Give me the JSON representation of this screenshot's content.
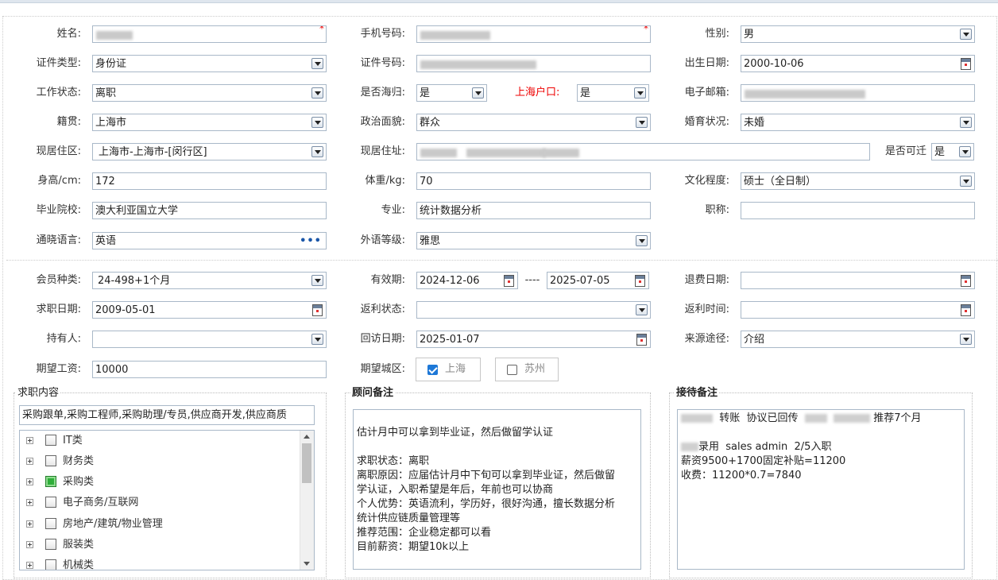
{
  "form": {
    "name_label": "姓名:",
    "phone_label": "手机号码:",
    "gender_label": "性别:",
    "gender_value": "男",
    "idtype_label": "证件类型:",
    "idtype_value": "身份证",
    "idno_label": "证件号码:",
    "birth_label": "出生日期:",
    "birth_value": "2000-10-06",
    "workstatus_label": "工作状态:",
    "workstatus_value": "离职",
    "returnee_label": "是否海归:",
    "returnee_value": "是",
    "hukou_label": "上海户口:",
    "hukou_value": "是",
    "email_label": "电子邮箱:",
    "native_label": "籍贯:",
    "native_value": "上海市",
    "political_label": "政治面貌:",
    "political_value": "群众",
    "marital_label": "婚育状况:",
    "marital_value": "未婚",
    "residence_label": "现居住区:",
    "residence_value": "上海市-上海市-[闵行区]",
    "address_label": "现居住址:",
    "relocate_label": "是否可迁",
    "relocate_value": "是",
    "height_label": "身高/cm:",
    "height_value": "172",
    "weight_label": "体重/kg:",
    "weight_value": "70",
    "education_label": "文化程度:",
    "education_value": "硕士（全日制）",
    "school_label": "毕业院校:",
    "school_value": "澳大利亚国立大学",
    "major_label": "专业:",
    "major_value": "统计数据分析",
    "title_label": "职称:",
    "title_value": "",
    "language_label": "通晓语言:",
    "language_value": "英语",
    "language_more": "•••",
    "level_label": "外语等级:",
    "level_value": "雅思",
    "membership_label": "会员种类:",
    "membership_value": "24-498+1个月",
    "valid_label": "有效期:",
    "valid_from": "2024-12-06",
    "valid_sep": "----",
    "valid_to": "2025-07-05",
    "refund_label": "退费日期:",
    "refund_value": "",
    "jobdate_label": "求职日期:",
    "jobdate_value": "2009-05-01",
    "rebate_status_label": "返利状态:",
    "rebate_status_value": "",
    "rebate_time_label": "返利时间:",
    "rebate_time_value": "",
    "holder_label": "持有人:",
    "holder_value": "",
    "revisit_label": "回访日期:",
    "revisit_value": "2025-01-07",
    "source_label": "来源途径:",
    "source_value": "介绍",
    "salary_label": "期望工资:",
    "salary_value": "10000",
    "city_label": "期望城区:",
    "city_options": [
      {
        "label": "上海",
        "checked": true
      },
      {
        "label": "苏州",
        "checked": false
      }
    ],
    "required_mark": "*"
  },
  "job_panel": {
    "title": "求职内容",
    "summary": "采购跟单,采购工程师,采购助理/专员,供应商开发,供应商质",
    "tree": [
      {
        "label": "IT类",
        "checked": false
      },
      {
        "label": "财务类",
        "checked": false
      },
      {
        "label": "采购类",
        "checked": true
      },
      {
        "label": "电子商务/互联网",
        "checked": false
      },
      {
        "label": "房地产/建筑/物业管理",
        "checked": false
      },
      {
        "label": "服装类",
        "checked": false
      },
      {
        "label": "机械类",
        "checked": false
      }
    ]
  },
  "advisor_panel": {
    "title": "顾问备注",
    "lines": [
      "",
      "估计月中可以拿到毕业证，然后做留学认证",
      "",
      "求职状态：离职",
      "离职原因：应届估计月中下旬可以拿到毕业证，然后做留",
      "学认证，入职希望是年后，年前也可以协商",
      "个人优势：英语流利，学历好，很好沟通，擅长数据分析",
      "统计供应链质量管理等",
      "推荐范围：企业稳定都可以看",
      "目前薪资：期望10k以上"
    ]
  },
  "reception_panel": {
    "title": "接待备注",
    "line1_a": "转账  协议已回传",
    "line1_b": "推荐7个月",
    "line3_a": "录用  sales admin  2/5入职",
    "line4": "薪资9500+1700固定补贴=11200",
    "line5": "收费：11200*0.7=7840"
  }
}
